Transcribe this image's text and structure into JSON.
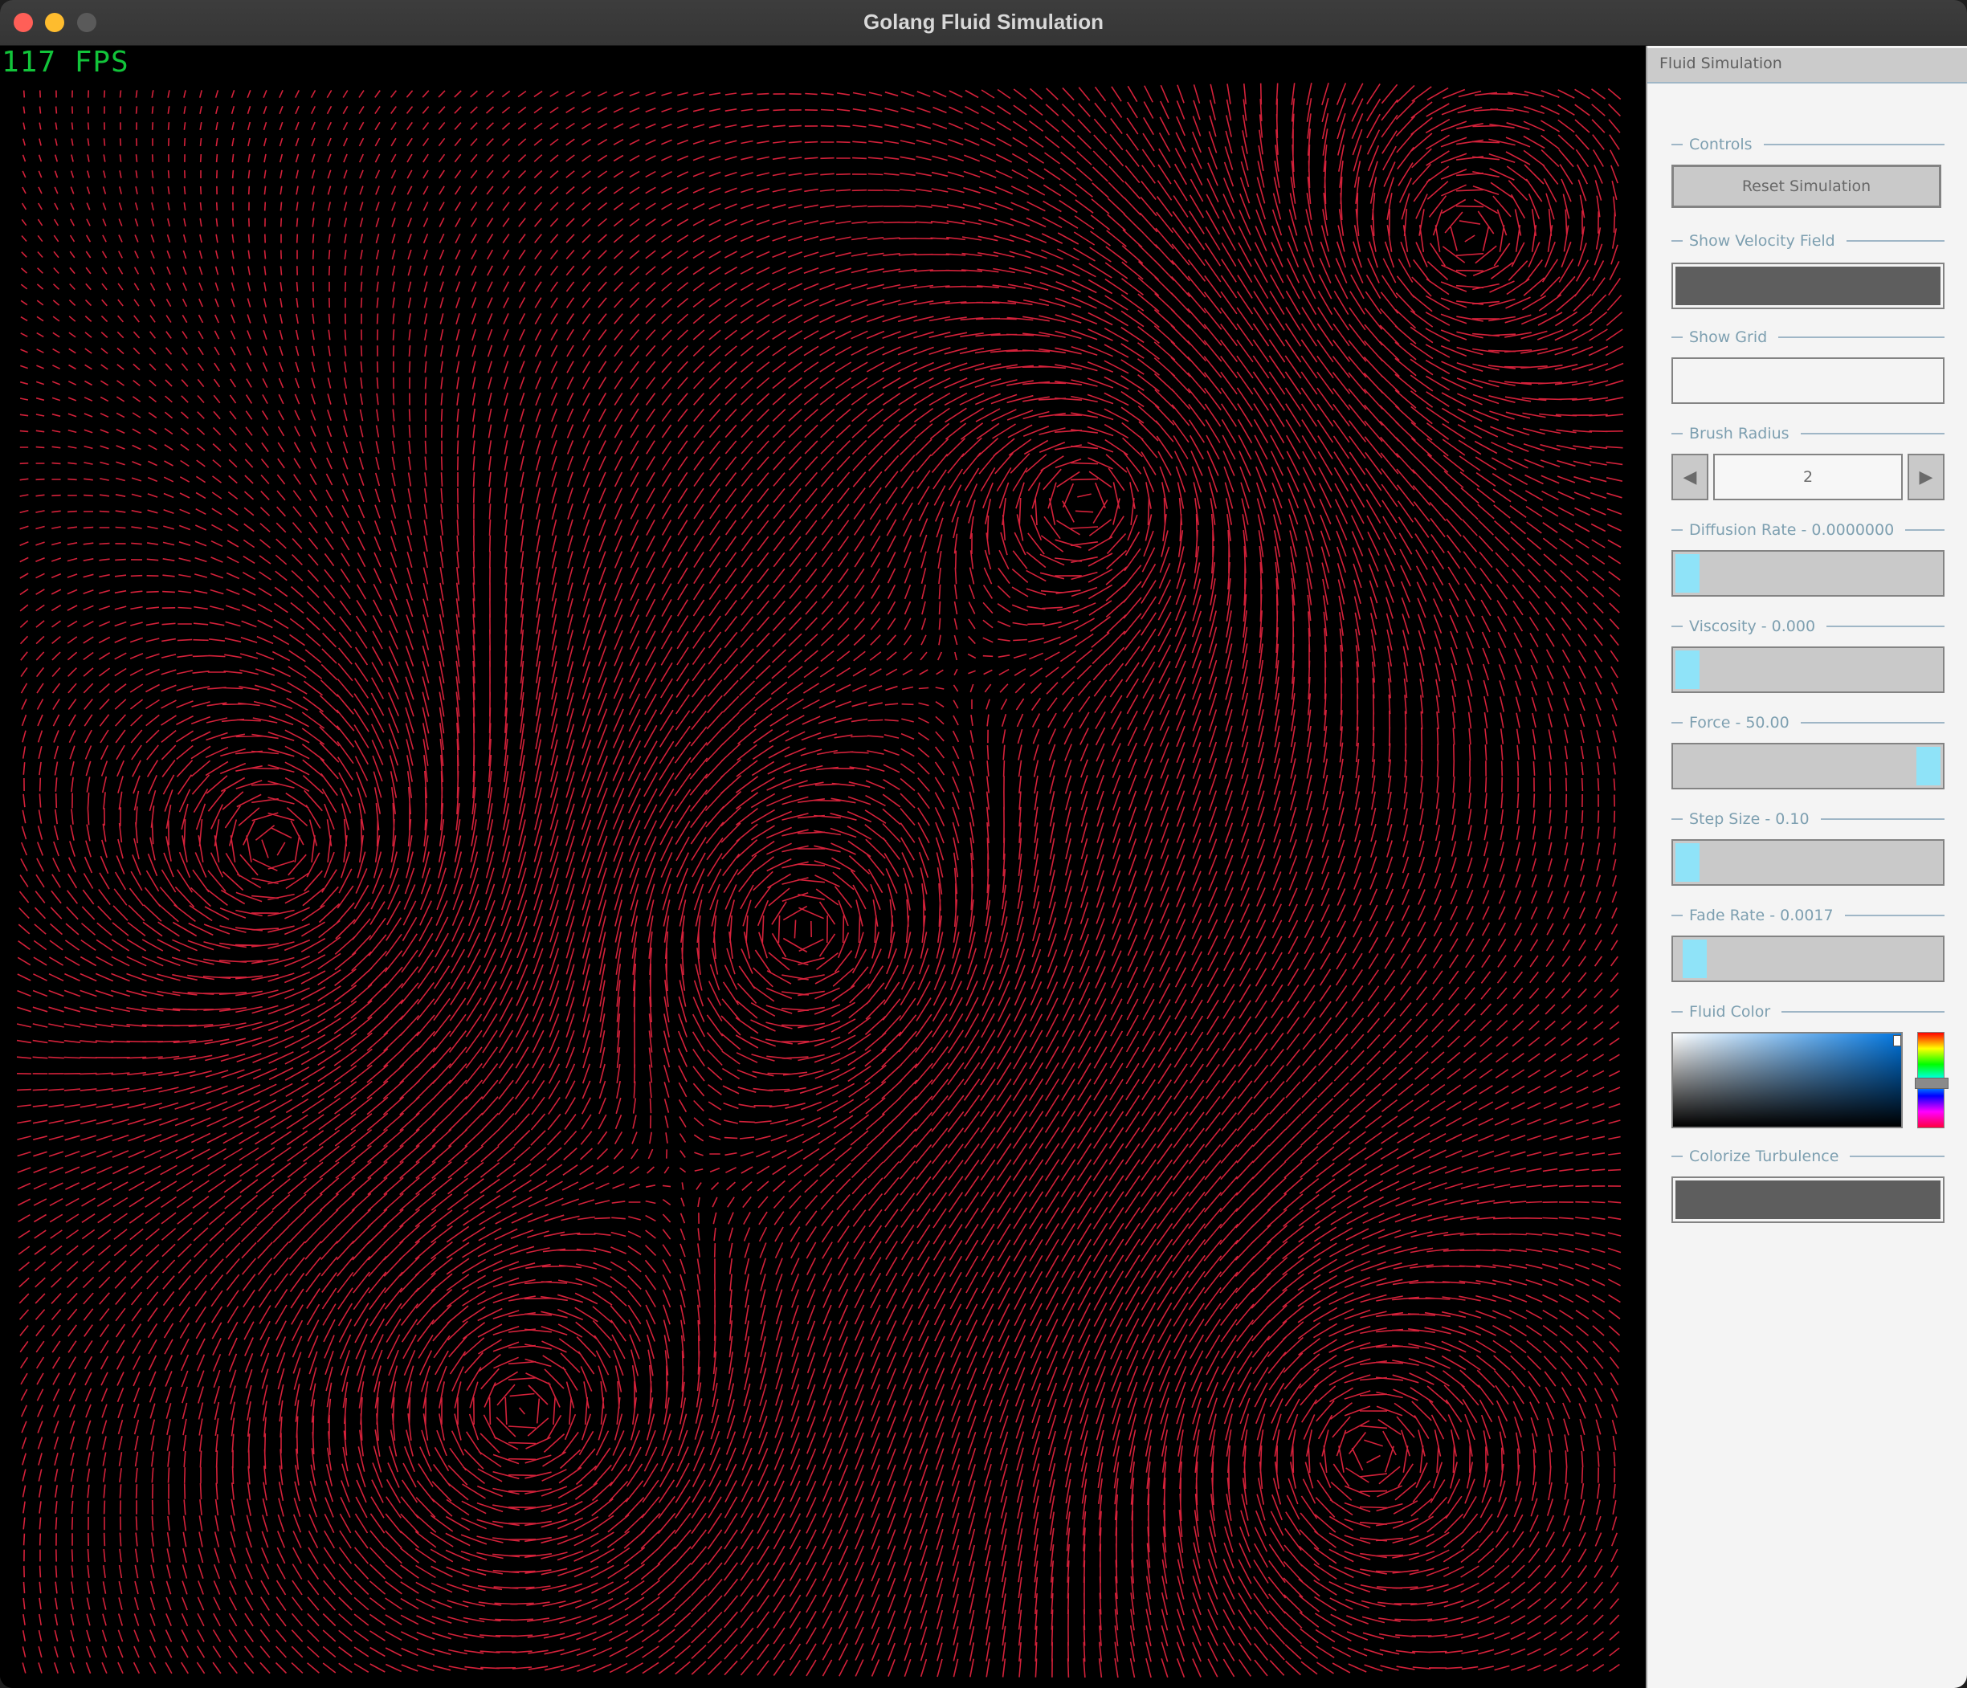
{
  "window": {
    "title": "Golang Fluid Simulation",
    "buttons": [
      "close",
      "minimize",
      "maximize"
    ]
  },
  "overlay": {
    "fps_text": "117 FPS",
    "fps_color": "#12c43a"
  },
  "canvas": {
    "background": "#000000",
    "line_color": "#d4213a",
    "content": "velocity-field"
  },
  "panel": {
    "title": "Fluid Simulation",
    "groups": {
      "controls": "Controls",
      "show_velocity": "Show Velocity Field",
      "show_grid": "Show Grid",
      "brush_radius": "Brush Radius",
      "diffusion": "Diffusion Rate - 0.0000000",
      "viscosity": "Viscosity - 0.000",
      "force": "Force - 50.00",
      "step_size": "Step Size - 0.10",
      "fade_rate": "Fade Rate - 0.0017",
      "fluid_color": "Fluid Color",
      "colorize": "Colorize Turbulence"
    },
    "reset_label": "Reset Simulation",
    "show_velocity_on": true,
    "show_grid_on": false,
    "colorize_on": true,
    "brush_radius_value": "2",
    "sliders": {
      "diffusion": 0.0,
      "viscosity": 0.0,
      "force": 1.0,
      "step_size": 0.0,
      "fade_rate": 0.03
    },
    "accent_color": "#8fe3f8",
    "fluid_color_hue": "#0076e0"
  }
}
